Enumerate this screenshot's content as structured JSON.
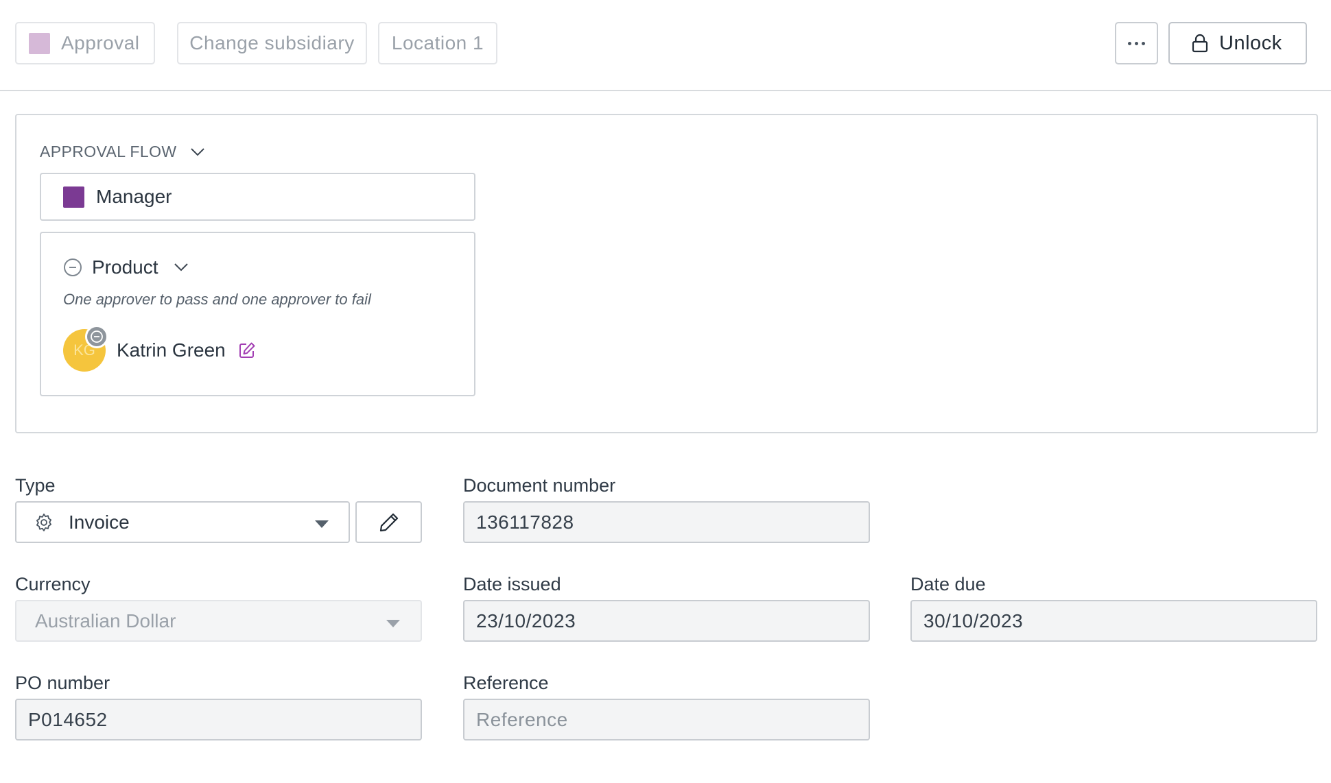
{
  "toolbar": {
    "approval_chip": "Approval",
    "subsidiary_chip": "Change subsidiary",
    "location_chip": "Location 1",
    "unlock_label": "Unlock"
  },
  "approval_flow": {
    "heading": "APPROVAL FLOW",
    "manager_label": "Manager",
    "product": {
      "title": "Product",
      "description": "One approver to pass and one approver to fail",
      "approver": {
        "initials": "KG",
        "name": "Katrin Green"
      }
    }
  },
  "form": {
    "type": {
      "label": "Type",
      "value": "Invoice"
    },
    "document_number": {
      "label": "Document number",
      "value": "136117828"
    },
    "currency": {
      "label": "Currency",
      "value": "Australian Dollar"
    },
    "date_issued": {
      "label": "Date issued",
      "value": "23/10/2023"
    },
    "date_due": {
      "label": "Date due",
      "value": "30/10/2023"
    },
    "po_number": {
      "label": "PO number",
      "value": "P014652"
    },
    "reference": {
      "label": "Reference",
      "placeholder": "Reference"
    }
  },
  "colors": {
    "approval_swatch": "#d6b9d8",
    "manager_swatch": "#7b3a93",
    "avatar": "#f5c53d",
    "edit_icon": "#a33fb3"
  },
  "icons": [
    "lock-icon",
    "more-dots-icon",
    "chevron-down-icon",
    "minus-circle-icon",
    "edit-icon",
    "gear-icon",
    "pencil-icon",
    "caret-down-icon"
  ]
}
